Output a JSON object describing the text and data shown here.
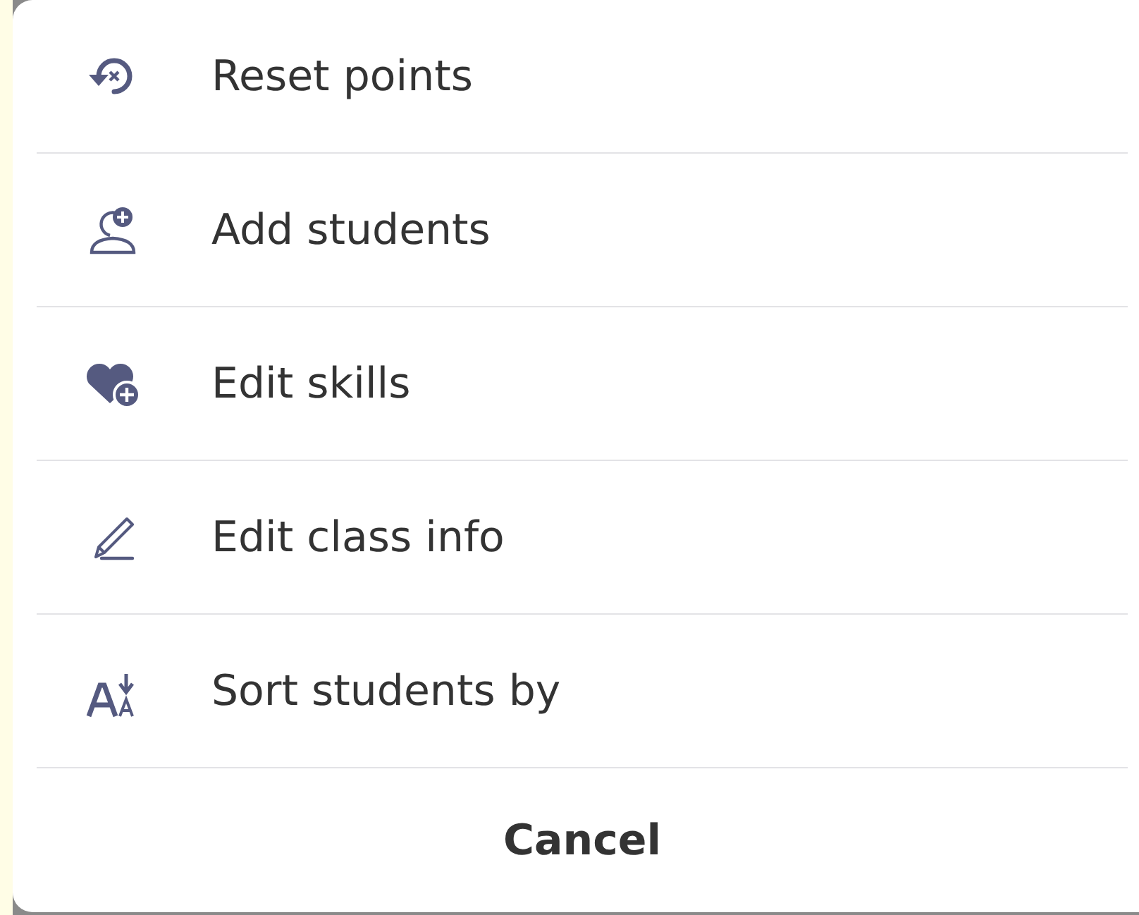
{
  "menu": {
    "items": [
      {
        "kind": "reset",
        "label": "Reset points"
      },
      {
        "kind": "add-student",
        "label": "Add students"
      },
      {
        "kind": "heart-add",
        "label": "Edit skills"
      },
      {
        "kind": "pencil",
        "label": "Edit class info"
      },
      {
        "kind": "sort",
        "label": "Sort students by"
      }
    ],
    "cancel": "Cancel"
  }
}
